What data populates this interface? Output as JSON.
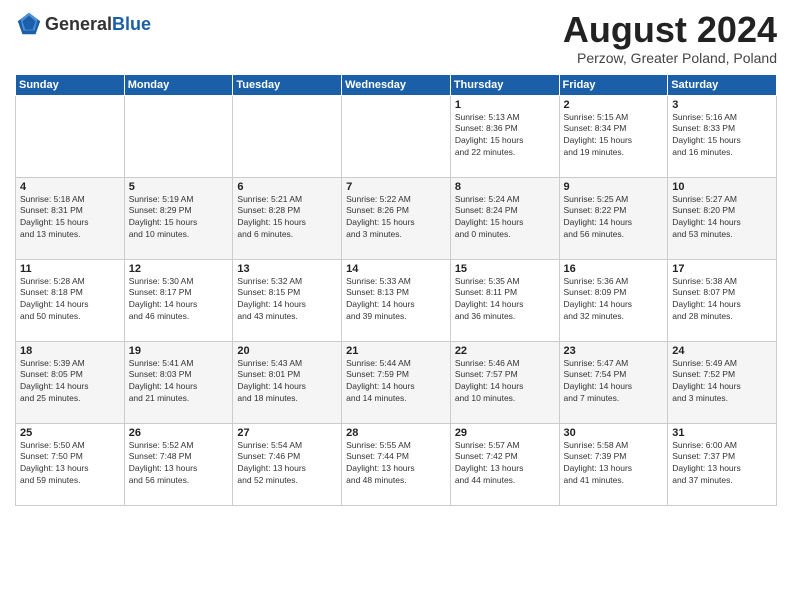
{
  "header": {
    "logo_general": "General",
    "logo_blue": "Blue",
    "title": "August 2024",
    "subtitle": "Perzow, Greater Poland, Poland"
  },
  "weekdays": [
    "Sunday",
    "Monday",
    "Tuesday",
    "Wednesday",
    "Thursday",
    "Friday",
    "Saturday"
  ],
  "weeks": [
    [
      {
        "day": "",
        "info": ""
      },
      {
        "day": "",
        "info": ""
      },
      {
        "day": "",
        "info": ""
      },
      {
        "day": "",
        "info": ""
      },
      {
        "day": "1",
        "info": "Sunrise: 5:13 AM\nSunset: 8:36 PM\nDaylight: 15 hours\nand 22 minutes."
      },
      {
        "day": "2",
        "info": "Sunrise: 5:15 AM\nSunset: 8:34 PM\nDaylight: 15 hours\nand 19 minutes."
      },
      {
        "day": "3",
        "info": "Sunrise: 5:16 AM\nSunset: 8:33 PM\nDaylight: 15 hours\nand 16 minutes."
      }
    ],
    [
      {
        "day": "4",
        "info": "Sunrise: 5:18 AM\nSunset: 8:31 PM\nDaylight: 15 hours\nand 13 minutes."
      },
      {
        "day": "5",
        "info": "Sunrise: 5:19 AM\nSunset: 8:29 PM\nDaylight: 15 hours\nand 10 minutes."
      },
      {
        "day": "6",
        "info": "Sunrise: 5:21 AM\nSunset: 8:28 PM\nDaylight: 15 hours\nand 6 minutes."
      },
      {
        "day": "7",
        "info": "Sunrise: 5:22 AM\nSunset: 8:26 PM\nDaylight: 15 hours\nand 3 minutes."
      },
      {
        "day": "8",
        "info": "Sunrise: 5:24 AM\nSunset: 8:24 PM\nDaylight: 15 hours\nand 0 minutes."
      },
      {
        "day": "9",
        "info": "Sunrise: 5:25 AM\nSunset: 8:22 PM\nDaylight: 14 hours\nand 56 minutes."
      },
      {
        "day": "10",
        "info": "Sunrise: 5:27 AM\nSunset: 8:20 PM\nDaylight: 14 hours\nand 53 minutes."
      }
    ],
    [
      {
        "day": "11",
        "info": "Sunrise: 5:28 AM\nSunset: 8:18 PM\nDaylight: 14 hours\nand 50 minutes."
      },
      {
        "day": "12",
        "info": "Sunrise: 5:30 AM\nSunset: 8:17 PM\nDaylight: 14 hours\nand 46 minutes."
      },
      {
        "day": "13",
        "info": "Sunrise: 5:32 AM\nSunset: 8:15 PM\nDaylight: 14 hours\nand 43 minutes."
      },
      {
        "day": "14",
        "info": "Sunrise: 5:33 AM\nSunset: 8:13 PM\nDaylight: 14 hours\nand 39 minutes."
      },
      {
        "day": "15",
        "info": "Sunrise: 5:35 AM\nSunset: 8:11 PM\nDaylight: 14 hours\nand 36 minutes."
      },
      {
        "day": "16",
        "info": "Sunrise: 5:36 AM\nSunset: 8:09 PM\nDaylight: 14 hours\nand 32 minutes."
      },
      {
        "day": "17",
        "info": "Sunrise: 5:38 AM\nSunset: 8:07 PM\nDaylight: 14 hours\nand 28 minutes."
      }
    ],
    [
      {
        "day": "18",
        "info": "Sunrise: 5:39 AM\nSunset: 8:05 PM\nDaylight: 14 hours\nand 25 minutes."
      },
      {
        "day": "19",
        "info": "Sunrise: 5:41 AM\nSunset: 8:03 PM\nDaylight: 14 hours\nand 21 minutes."
      },
      {
        "day": "20",
        "info": "Sunrise: 5:43 AM\nSunset: 8:01 PM\nDaylight: 14 hours\nand 18 minutes."
      },
      {
        "day": "21",
        "info": "Sunrise: 5:44 AM\nSunset: 7:59 PM\nDaylight: 14 hours\nand 14 minutes."
      },
      {
        "day": "22",
        "info": "Sunrise: 5:46 AM\nSunset: 7:57 PM\nDaylight: 14 hours\nand 10 minutes."
      },
      {
        "day": "23",
        "info": "Sunrise: 5:47 AM\nSunset: 7:54 PM\nDaylight: 14 hours\nand 7 minutes."
      },
      {
        "day": "24",
        "info": "Sunrise: 5:49 AM\nSunset: 7:52 PM\nDaylight: 14 hours\nand 3 minutes."
      }
    ],
    [
      {
        "day": "25",
        "info": "Sunrise: 5:50 AM\nSunset: 7:50 PM\nDaylight: 13 hours\nand 59 minutes."
      },
      {
        "day": "26",
        "info": "Sunrise: 5:52 AM\nSunset: 7:48 PM\nDaylight: 13 hours\nand 56 minutes."
      },
      {
        "day": "27",
        "info": "Sunrise: 5:54 AM\nSunset: 7:46 PM\nDaylight: 13 hours\nand 52 minutes."
      },
      {
        "day": "28",
        "info": "Sunrise: 5:55 AM\nSunset: 7:44 PM\nDaylight: 13 hours\nand 48 minutes."
      },
      {
        "day": "29",
        "info": "Sunrise: 5:57 AM\nSunset: 7:42 PM\nDaylight: 13 hours\nand 44 minutes."
      },
      {
        "day": "30",
        "info": "Sunrise: 5:58 AM\nSunset: 7:39 PM\nDaylight: 13 hours\nand 41 minutes."
      },
      {
        "day": "31",
        "info": "Sunrise: 6:00 AM\nSunset: 7:37 PM\nDaylight: 13 hours\nand 37 minutes."
      }
    ]
  ]
}
